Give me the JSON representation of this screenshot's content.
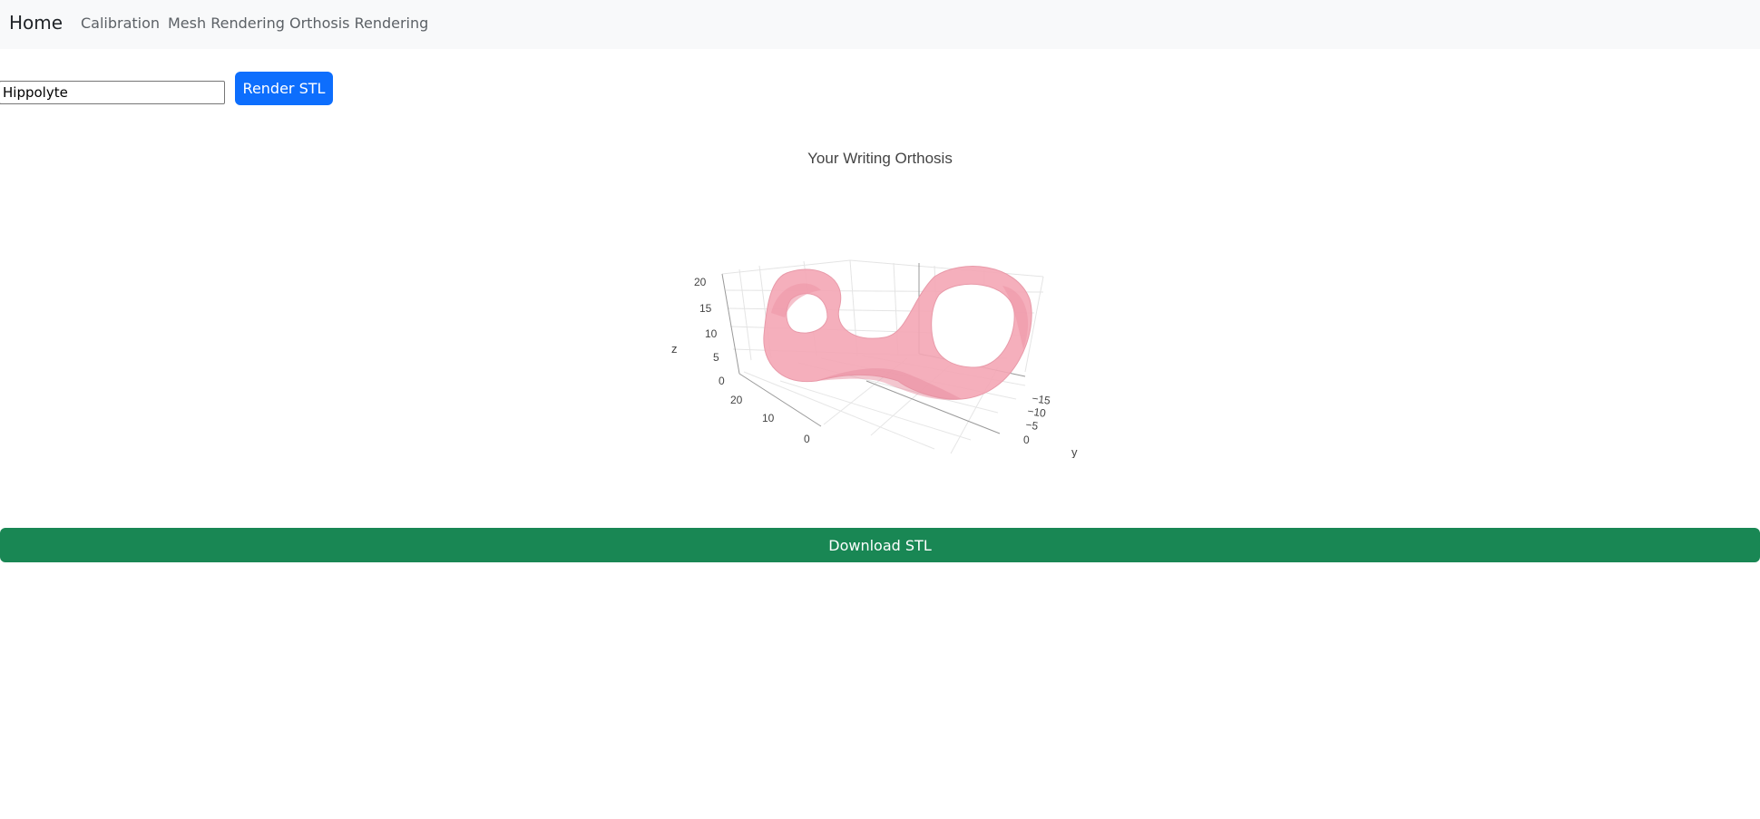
{
  "nav": {
    "brand": "Home",
    "links": [
      "Calibration",
      "Mesh Rendering",
      "Orthosis Rendering"
    ]
  },
  "form": {
    "name_value": "Hippolyte",
    "render_label": "Render STL"
  },
  "plot": {
    "title": "Your Writing Orthosis",
    "z_label": "z",
    "y_label": "y",
    "z_ticks": [
      "20",
      "15",
      "10",
      "5",
      "0"
    ],
    "x_ticks": [
      "20",
      "10",
      "0"
    ],
    "y_ticks": [
      "−15",
      "−10",
      "−5",
      "0"
    ],
    "mesh_color": "#f4a6b5"
  },
  "download_label": "Download STL",
  "colors": {
    "navbar_bg": "#f8f9fa",
    "primary": "#0d6efd",
    "success": "#198754"
  }
}
